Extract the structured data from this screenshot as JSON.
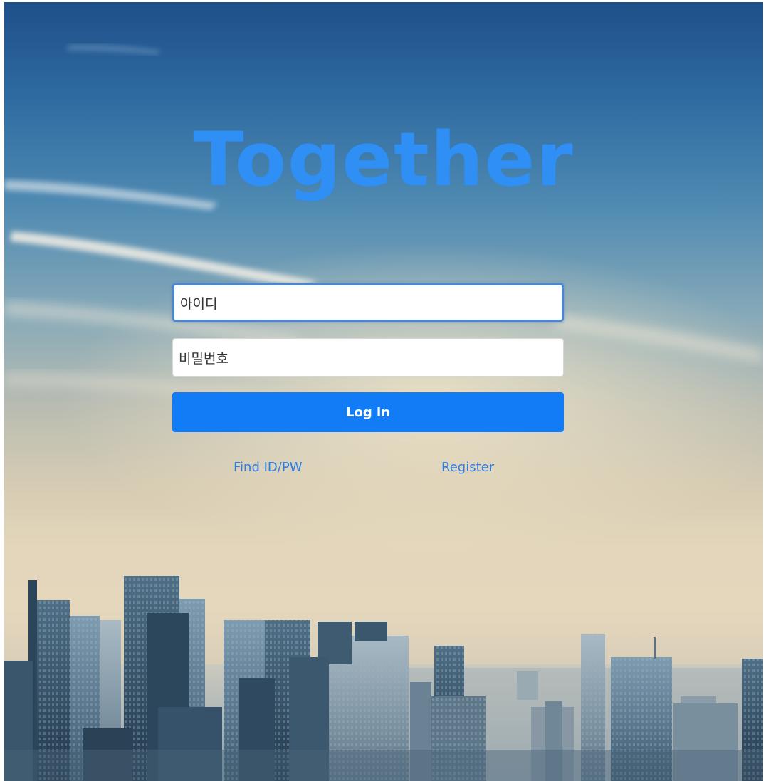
{
  "app": {
    "title": "Together"
  },
  "login_form": {
    "id_field": {
      "placeholder": "아이디",
      "value": ""
    },
    "password_field": {
      "placeholder": "비밀번호",
      "value": ""
    },
    "login_button_label": "Log in",
    "find_link_label": "Find ID/PW",
    "register_link_label": "Register"
  },
  "colors": {
    "brand": "#2f8ff5",
    "button": "#127cf7",
    "link": "#2f7de6",
    "focus_border": "#4d86cf"
  }
}
